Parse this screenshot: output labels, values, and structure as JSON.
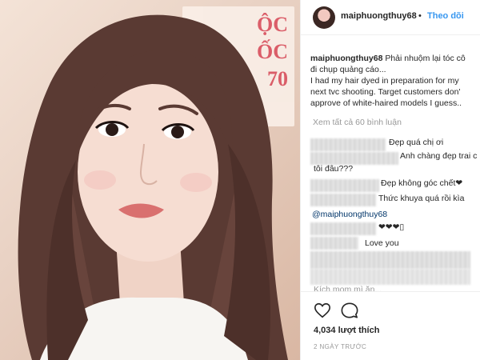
{
  "post": {
    "photo_sign_text": "ỘC\nỐC\n70",
    "accent_color": "#3897f0"
  },
  "header": {
    "username": "maiphuongthuy68",
    "separator": "•",
    "follow_label": "Theo dõi"
  },
  "caption": {
    "username": "maiphuongthuy68",
    "lines": [
      "Phải nhuộm lại tóc cô",
      "đi chụp quảng cáo...",
      "I had my hair dyed in preparation for my",
      "next tvc shooting. Target customers don'",
      "approve of white-haired models I guess.."
    ]
  },
  "view_all_label": "Xem tất cả 60 bình luận",
  "comments": [
    {
      "text": "Đẹp quá chị ơi"
    },
    {
      "text": "Anh chàng đẹp trai c",
      "text2": "tôi đâu???"
    },
    {
      "text": "Đẹp không góc chết❤"
    },
    {
      "text": "Thức khuya quá rồi kìa"
    },
    {
      "mention": "@maiphuongthuy68"
    },
    {
      "text": "❤❤❤▯"
    },
    {
      "text": "Love you"
    },
    {
      "text": "Kích mom mì ăn..."
    }
  ],
  "actions": {
    "like_icon": "heart-icon",
    "comment_icon": "comment-bubble-icon",
    "likes_label": "4,034 lượt thích",
    "timestamp": "2 NGÀY TRƯỚC"
  }
}
